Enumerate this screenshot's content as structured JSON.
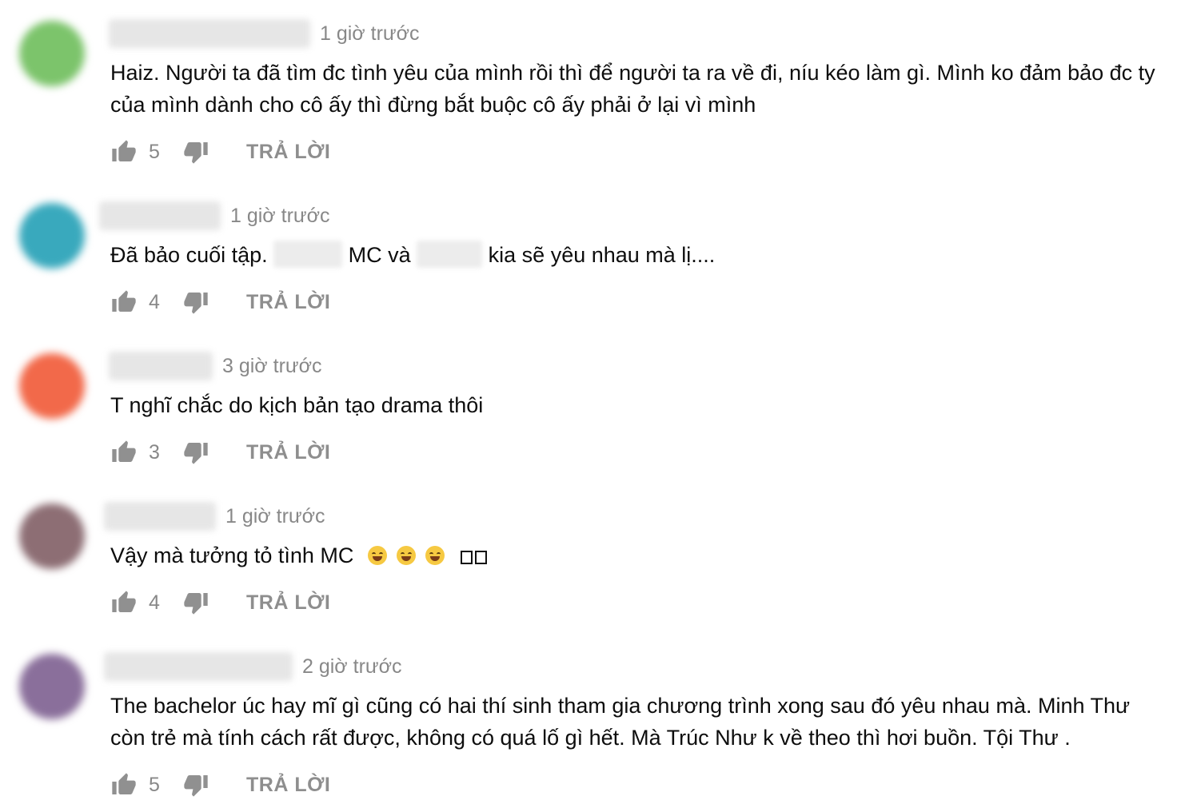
{
  "colors": {
    "avatars": [
      "#7cc46b",
      "#39a9bd",
      "#f2694a",
      "#8d6e74",
      "#8a6f9b"
    ],
    "muted": "#888888",
    "text": "#0d0d0d"
  },
  "icons": {
    "like": "thumbs-up-icon",
    "dislike": "thumbs-down-icon"
  },
  "comments": [
    {
      "time": "1 giờ trước",
      "text": "Haiz. Người ta đã tìm đc tình yêu của mình rồi thì để người ta ra về đi, níu kéo làm gì. Mình ko đảm bảo đc ty của mình dành cho cô ấy thì đừng bắt buộc cô ấy phải ở lại vì mình",
      "likes": "5",
      "reply_label": "TRẢ LỜI"
    },
    {
      "time": "1 giờ trước",
      "text_parts": [
        "Đã bảo cuối tập. ",
        " MC và ",
        " kia sẽ yêu nhau mà lị...."
      ],
      "likes": "4",
      "reply_label": "TRẢ LỜI"
    },
    {
      "time": "3 giờ trước",
      "text": "T nghĩ chắc do kịch bản tạo drama thôi",
      "likes": "3",
      "reply_label": "TRẢ LỜI"
    },
    {
      "time": "1 giờ trước",
      "text": "Vậy mà tưởng tỏ tình MC",
      "emoji_icon": "face-with-tears-of-joy-icon",
      "likes": "4",
      "reply_label": "TRẢ LỜI"
    },
    {
      "time": "2 giờ trước",
      "text": "The bachelor úc hay mĩ gì cũng có hai thí sinh tham gia chương trình xong sau đó yêu nhau mà. Minh Thư còn trẻ mà tính cách rất được, không có quá lố gì hết. Mà Trúc Như k về theo thì hơi buồn. Tội Thư .",
      "likes": "5",
      "reply_label": "TRẢ LỜI"
    }
  ]
}
